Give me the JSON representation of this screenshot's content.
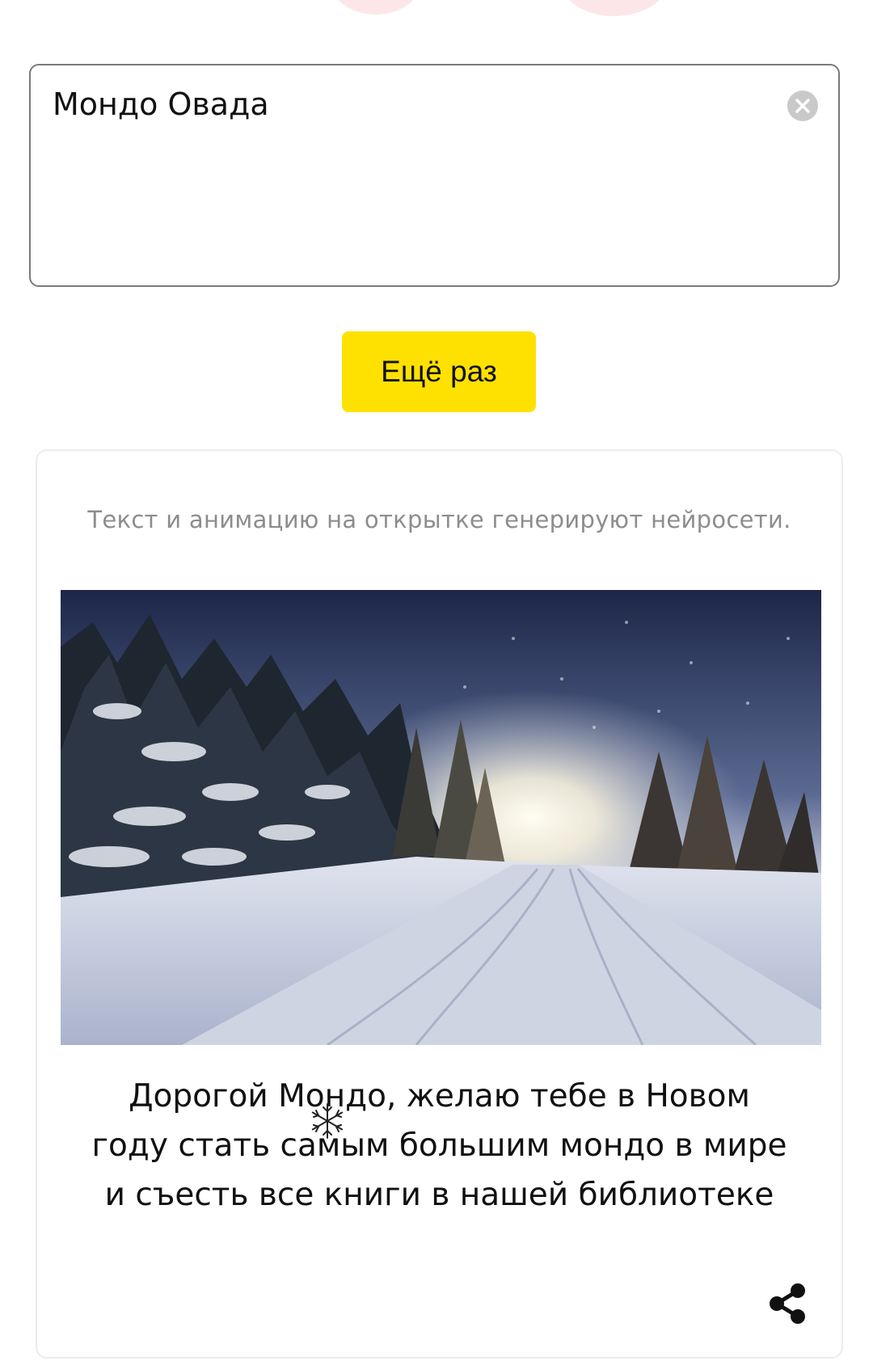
{
  "name_field": {
    "value": "Мондо Овада"
  },
  "again_button": {
    "label": "Ещё раз"
  },
  "card": {
    "disclaimer": "Текст и анимацию на открытке генерируют нейросети.",
    "greeting": "Дорогой Мондо, желаю тебе в Новом году стать самым большим мондо в мире и съесть все книги в нашей библиотеке",
    "image_description": "winter-forest-road-photo",
    "share_icon": "share-icon",
    "decoration_icon": "snowflake-icon"
  },
  "colors": {
    "accent_yellow": "#ffe100",
    "border_gray": "#7a7a7a",
    "disclaimer_gray": "#8d8d8d"
  }
}
